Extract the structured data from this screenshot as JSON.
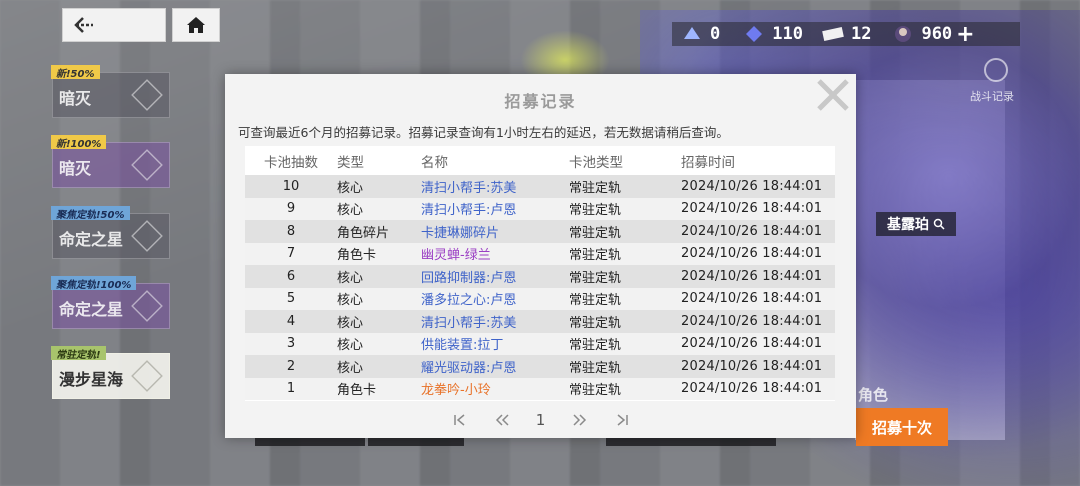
{
  "currency": {
    "shards": "0",
    "gems": "110",
    "tickets": "12",
    "credits": "960",
    "plus": "+"
  },
  "banners": [
    {
      "tag": "新!50%",
      "title": "暗灭",
      "tag_color": "#f0c948"
    },
    {
      "tag": "新!100%",
      "title": "暗灭",
      "tag_color": "#f0c948"
    },
    {
      "tag": "聚焦定轨!50%",
      "title": "命定之星",
      "tag_color": "#6fa5d8"
    },
    {
      "tag": "聚焦定轨!100%",
      "title": "命定之星",
      "tag_color": "#6fa5d8"
    },
    {
      "tag": "常驻定轨!",
      "title": "漫步星海",
      "tag_color": "#a8c46c"
    }
  ],
  "background": {
    "character_label": "基露珀",
    "side_label": "战斗记录",
    "color_label": "角色",
    "recruit_ten": "招募十次"
  },
  "modal": {
    "title": "招募记录",
    "note": "可查询最近6个月的招募记录。招募记录查询有1小时左右的延迟，若无数据请稍后查询。",
    "headers": {
      "num": "卡池抽数",
      "type": "类型",
      "name": "名称",
      "pool": "卡池类型",
      "time": "招募时间"
    },
    "rows": [
      {
        "num": "10",
        "type": "核心",
        "name": "清扫小帮手:苏美",
        "pool": "常驻定轨",
        "time": "2024/10/26 18:44:01",
        "color": "#3f63c9"
      },
      {
        "num": "9",
        "type": "核心",
        "name": "清扫小帮手:卢恩",
        "pool": "常驻定轨",
        "time": "2024/10/26 18:44:01",
        "color": "#3f63c9"
      },
      {
        "num": "8",
        "type": "角色碎片",
        "name": "卡捷琳娜碎片",
        "pool": "常驻定轨",
        "time": "2024/10/26 18:44:01",
        "color": "#3f63c9"
      },
      {
        "num": "7",
        "type": "角色卡",
        "name": "幽灵蝉-绿兰",
        "pool": "常驻定轨",
        "time": "2024/10/26 18:44:01",
        "color": "#9b3fc4"
      },
      {
        "num": "6",
        "type": "核心",
        "name": "回路抑制器:卢恩",
        "pool": "常驻定轨",
        "time": "2024/10/26 18:44:01",
        "color": "#3f63c9"
      },
      {
        "num": "5",
        "type": "核心",
        "name": "潘多拉之心:卢恩",
        "pool": "常驻定轨",
        "time": "2024/10/26 18:44:01",
        "color": "#3f63c9"
      },
      {
        "num": "4",
        "type": "核心",
        "name": "清扫小帮手:苏美",
        "pool": "常驻定轨",
        "time": "2024/10/26 18:44:01",
        "color": "#3f63c9"
      },
      {
        "num": "3",
        "type": "核心",
        "name": "供能装置:拉丁",
        "pool": "常驻定轨",
        "time": "2024/10/26 18:44:01",
        "color": "#3f63c9"
      },
      {
        "num": "2",
        "type": "核心",
        "name": "耀光驱动器:卢恩",
        "pool": "常驻定轨",
        "time": "2024/10/26 18:44:01",
        "color": "#3f63c9"
      },
      {
        "num": "1",
        "type": "角色卡",
        "name": "龙拳吟-小玲",
        "pool": "常驻定轨",
        "time": "2024/10/26 18:44:01",
        "color": "#e8732a"
      }
    ],
    "pager": {
      "current_page": "1"
    }
  }
}
